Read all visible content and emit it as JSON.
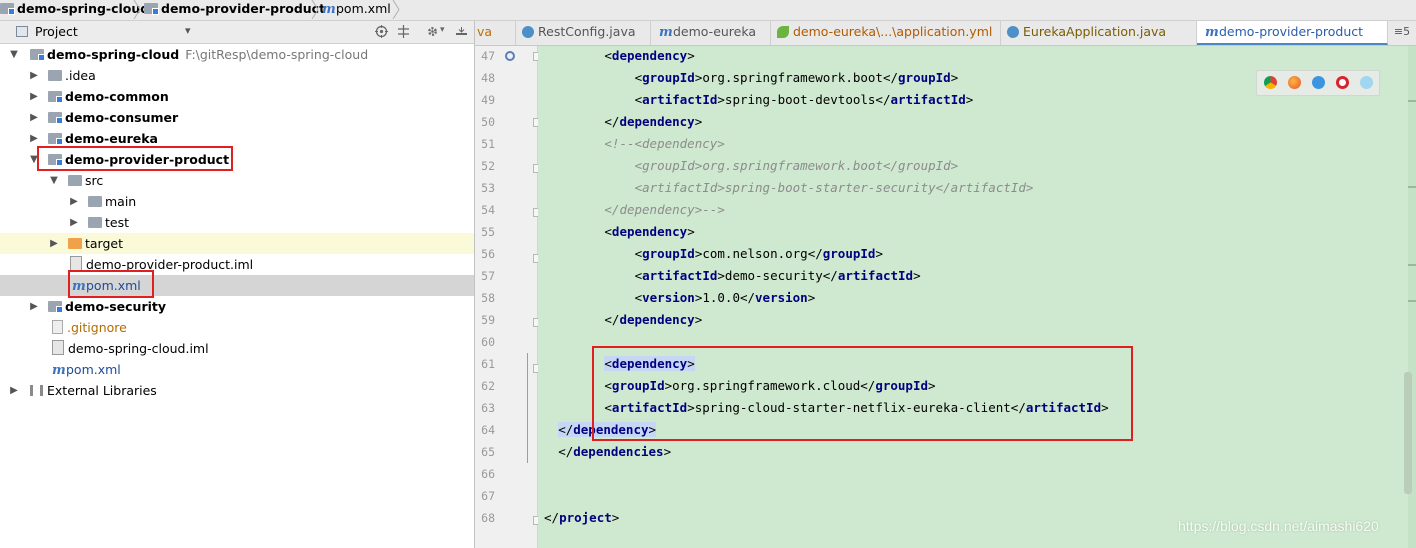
{
  "breadcrumb": {
    "items": [
      "demo-spring-cloud",
      "demo-provider-product",
      "pom.xml"
    ]
  },
  "project_panel": {
    "title": "Project",
    "dropdown_glyph": "▾",
    "toolbar_icons": [
      "globe-target-icon",
      "collapse-all-icon",
      "settings-gear-icon",
      "hide-panel-icon"
    ],
    "tree": [
      {
        "label": "demo-spring-cloud",
        "path": "F:\\gitResp\\demo-spring-cloud",
        "level": 0,
        "expanded": true,
        "icon": "module-folder-icon"
      },
      {
        "label": ".idea",
        "level": 1,
        "expanded": false,
        "icon": "folder-icon"
      },
      {
        "label": "demo-common",
        "level": 1,
        "expanded": false,
        "icon": "module-folder-icon"
      },
      {
        "label": "demo-consumer",
        "level": 1,
        "expanded": false,
        "icon": "module-folder-icon"
      },
      {
        "label": "demo-eureka",
        "level": 1,
        "expanded": false,
        "icon": "module-folder-icon"
      },
      {
        "label": "demo-provider-product",
        "level": 1,
        "expanded": true,
        "icon": "module-folder-icon"
      },
      {
        "label": "src",
        "level": 2,
        "expanded": true,
        "icon": "folder-icon"
      },
      {
        "label": "main",
        "level": 3,
        "expanded": false,
        "icon": "folder-icon"
      },
      {
        "label": "test",
        "level": 3,
        "expanded": false,
        "icon": "folder-icon"
      },
      {
        "label": "target",
        "level": 2,
        "expanded": false,
        "icon": "orange-folder-icon"
      },
      {
        "label": "demo-provider-product.iml",
        "level": 2,
        "icon": "iml-file-icon"
      },
      {
        "label": "pom.xml",
        "level": 2,
        "icon": "maven-file-icon",
        "selected": true
      },
      {
        "label": "demo-security",
        "level": 1,
        "expanded": false,
        "icon": "module-folder-icon"
      },
      {
        "label": ".gitignore",
        "level": 1,
        "icon": "gitignore-file-icon"
      },
      {
        "label": "demo-spring-cloud.iml",
        "level": 1,
        "icon": "iml-file-icon"
      },
      {
        "label": "pom.xml",
        "level": 1,
        "icon": "maven-file-icon"
      },
      {
        "label": "External Libraries",
        "level": 0,
        "expanded": false,
        "icon": "libraries-icon"
      }
    ]
  },
  "editor": {
    "tabs": [
      {
        "label": "va",
        "icon": ""
      },
      {
        "label": "RestConfig.java",
        "icon": "java-class-icon"
      },
      {
        "label": "demo-eureka",
        "icon": "maven-file-icon"
      },
      {
        "label": "demo-eureka\\...\\application.yml",
        "icon": "spring-leaf-icon"
      },
      {
        "label": "EurekaApplication.java",
        "icon": "java-class-icon"
      },
      {
        "label": "demo-provider-product",
        "icon": "maven-file-icon",
        "active": true
      },
      {
        "label": "≡5",
        "icon": ""
      }
    ],
    "lines": [
      {
        "n": "47",
        "indent": 4,
        "parts": [
          [
            "br",
            "<"
          ],
          [
            "tag",
            "dependency"
          ],
          [
            "br",
            ">"
          ]
        ]
      },
      {
        "n": "48",
        "indent": 6,
        "parts": [
          [
            "br",
            "<"
          ],
          [
            "tag",
            "groupId"
          ],
          [
            "br",
            ">org.springframework.boot</"
          ],
          [
            "tag",
            "groupId"
          ],
          [
            "br",
            ">"
          ]
        ]
      },
      {
        "n": "49",
        "indent": 6,
        "parts": [
          [
            "br",
            "<"
          ],
          [
            "tag",
            "artifactId"
          ],
          [
            "br",
            ">spring-boot-devtools</"
          ],
          [
            "tag",
            "artifactId"
          ],
          [
            "br",
            ">"
          ]
        ]
      },
      {
        "n": "50",
        "indent": 4,
        "parts": [
          [
            "br",
            "</"
          ],
          [
            "tag",
            "dependency"
          ],
          [
            "br",
            ">"
          ]
        ]
      },
      {
        "n": "51",
        "indent": 4,
        "parts": [
          [
            "cm",
            "<!--<dependency>"
          ]
        ]
      },
      {
        "n": "52",
        "indent": 6,
        "parts": [
          [
            "cm",
            "<groupId>org.springframework.boot</groupId>"
          ]
        ]
      },
      {
        "n": "53",
        "indent": 6,
        "parts": [
          [
            "cm",
            "<artifactId>spring-boot-starter-security</artifactId>"
          ]
        ]
      },
      {
        "n": "54",
        "indent": 4,
        "parts": [
          [
            "cm",
            "</dependency>-->"
          ]
        ]
      },
      {
        "n": "55",
        "indent": 4,
        "parts": [
          [
            "br",
            "<"
          ],
          [
            "tag",
            "dependency"
          ],
          [
            "br",
            ">"
          ]
        ]
      },
      {
        "n": "56",
        "indent": 6,
        "parts": [
          [
            "br",
            "<"
          ],
          [
            "tag",
            "groupId"
          ],
          [
            "br",
            ">com.nelson.org</"
          ],
          [
            "tag",
            "groupId"
          ],
          [
            "br",
            ">"
          ]
        ]
      },
      {
        "n": "57",
        "indent": 6,
        "parts": [
          [
            "br",
            "<"
          ],
          [
            "tag",
            "artifactId"
          ],
          [
            "br",
            ">demo-security</"
          ],
          [
            "tag",
            "artifactId"
          ],
          [
            "br",
            ">"
          ]
        ]
      },
      {
        "n": "58",
        "indent": 6,
        "parts": [
          [
            "br",
            "<"
          ],
          [
            "tag",
            "version"
          ],
          [
            "br",
            ">1.0.0</"
          ],
          [
            "tag",
            "version"
          ],
          [
            "br",
            ">"
          ]
        ]
      },
      {
        "n": "59",
        "indent": 4,
        "parts": [
          [
            "br",
            "</"
          ],
          [
            "tag",
            "dependency"
          ],
          [
            "br",
            ">"
          ]
        ]
      },
      {
        "n": "60",
        "indent": 0,
        "parts": []
      },
      {
        "n": "61",
        "indent": 4,
        "hl": true,
        "parts": [
          [
            "br",
            "<"
          ],
          [
            "tag",
            "dependency"
          ],
          [
            "br",
            ">"
          ]
        ]
      },
      {
        "n": "62",
        "indent": 4,
        "parts": [
          [
            "br",
            "<"
          ],
          [
            "tag",
            "groupId"
          ],
          [
            "br",
            ">org.springframework.cloud</"
          ],
          [
            "tag",
            "groupId"
          ],
          [
            "br",
            ">"
          ]
        ]
      },
      {
        "n": "63",
        "indent": 4,
        "parts": [
          [
            "br",
            "<"
          ],
          [
            "tag",
            "artifactId"
          ],
          [
            "br",
            ">spring-cloud-starter-netflix-eureka-client</"
          ],
          [
            "tag",
            "artifactId"
          ],
          [
            "br",
            ">"
          ]
        ]
      },
      {
        "n": "64",
        "indent": 2,
        "hl": true,
        "parts": [
          [
            "br",
            "</"
          ],
          [
            "tag",
            "dependency"
          ],
          [
            "br",
            ">"
          ]
        ]
      },
      {
        "n": "65",
        "indent": 2,
        "parts": [
          [
            "br",
            "</"
          ],
          [
            "tag",
            "dependencies"
          ],
          [
            "br",
            ">"
          ]
        ]
      },
      {
        "n": "66",
        "indent": 0,
        "parts": []
      },
      {
        "n": "67",
        "indent": 0,
        "parts": []
      },
      {
        "n": "68",
        "indent": 0,
        "parts": [
          [
            "br",
            "</"
          ],
          [
            "tag",
            "project"
          ],
          [
            "br",
            ">"
          ]
        ]
      }
    ],
    "browser_icons": [
      "chrome-icon",
      "firefox-icon",
      "safari-icon",
      "opera-icon",
      "ie-icon"
    ],
    "watermark": "https://blog.csdn.net/aimashi620"
  },
  "colors": {
    "editor_bg": "#cfe9d0",
    "tag": "#000080",
    "annotation_box": "#e02020",
    "selection": "#c6d7f5"
  }
}
